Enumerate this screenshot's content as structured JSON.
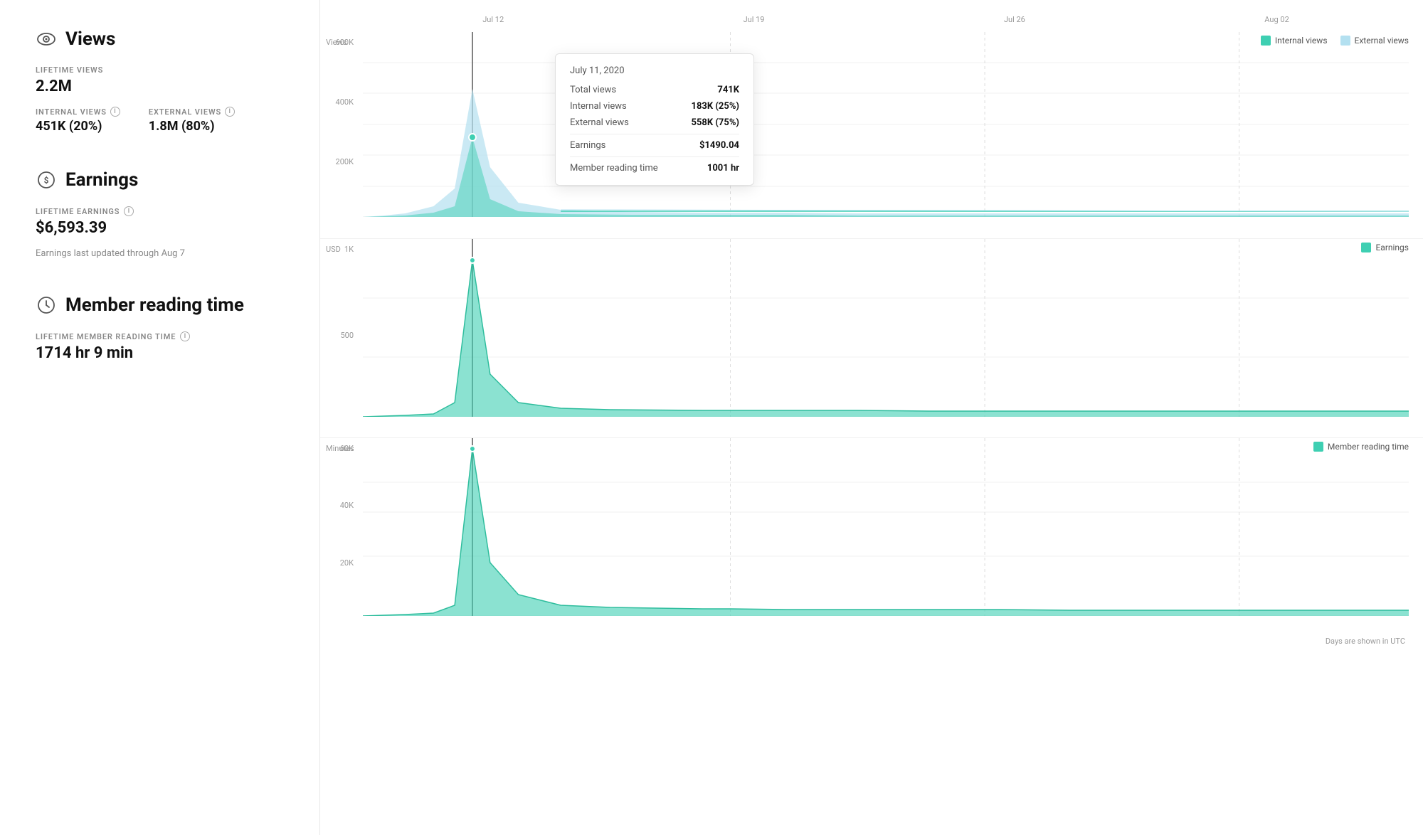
{
  "left": {
    "views": {
      "section_title": "Views",
      "lifetime_label": "LIFETIME VIEWS",
      "lifetime_value": "2.2M",
      "internal_label": "INTERNAL VIEWS",
      "internal_value": "451K (20%)",
      "external_label": "EXTERNAL VIEWS",
      "external_value": "1.8M (80%)"
    },
    "earnings": {
      "section_title": "Earnings",
      "lifetime_label": "LIFETIME EARNINGS",
      "lifetime_value": "$6,593.39",
      "note": "Earnings last updated through Aug 7"
    },
    "reading": {
      "section_title": "Member reading time",
      "lifetime_label": "LIFETIME MEMBER READING TIME",
      "lifetime_value": "1714 hr 9 min"
    }
  },
  "chart": {
    "x_labels": [
      "Jul 12",
      "Jul 19",
      "Jul 26",
      "Aug 02"
    ],
    "views_y_labels": [
      "600K",
      "400K",
      "200K",
      ""
    ],
    "views_unit": "Views",
    "earnings_y_labels": [
      "1K",
      "500",
      ""
    ],
    "earnings_unit": "USD",
    "reading_y_labels": [
      "60K",
      "40K",
      "20K",
      ""
    ],
    "reading_unit": "Minutes",
    "legend_internal": "Internal views",
    "legend_external": "External views",
    "legend_earnings": "Earnings",
    "legend_reading": "Member reading time"
  },
  "tooltip": {
    "date": "July 11, 2020",
    "total_views_label": "Total views",
    "total_views_value": "741K",
    "internal_label": "Internal views",
    "internal_value": "183K (25%)",
    "external_label": "External views",
    "external_value": "558K (75%)",
    "earnings_label": "Earnings",
    "earnings_value": "$1490.04",
    "reading_label": "Member reading time",
    "reading_value": "1001 hr"
  },
  "footer": {
    "utc_note": "Days are shown in UTC"
  }
}
